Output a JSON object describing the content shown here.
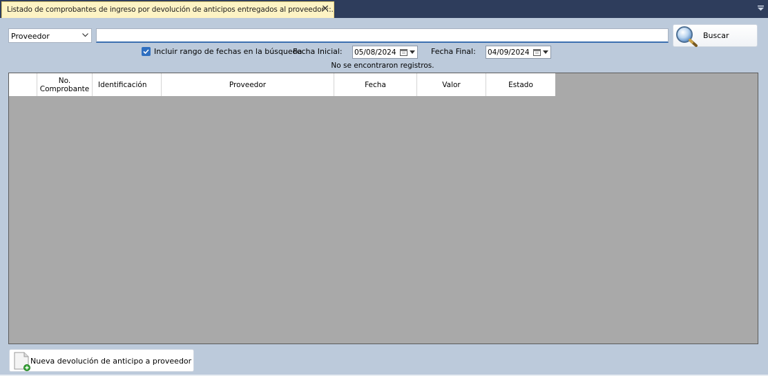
{
  "tab": {
    "title": "Listado de comprobantes de ingreso por devolución de anticipos entregados al proveedor ::.",
    "close_glyph": "✕"
  },
  "filters": {
    "field_select": {
      "value": "Proveedor"
    },
    "search": {
      "value": "",
      "placeholder": ""
    },
    "search_button_label": "Buscar",
    "date_range_checkbox": {
      "label": "Incluir rango de fechas en la búsqueda",
      "checked": true
    },
    "start_date": {
      "label": "Fecha Inicial:",
      "value": "05/08/2024"
    },
    "end_date": {
      "label": "Fecha Final:",
      "value": "04/09/2024"
    }
  },
  "status_message": "No se encontraron registros.",
  "grid": {
    "columns": [
      {
        "label": ""
      },
      {
        "label": "No.\nComprobante"
      },
      {
        "label": "Identificación"
      },
      {
        "label": "Proveedor"
      },
      {
        "label": "Fecha"
      },
      {
        "label": "Valor"
      },
      {
        "label": "Estado"
      }
    ],
    "rows": []
  },
  "footer": {
    "new_button_label": "Nueva devolución de anticipo a proveedor"
  },
  "icons": {
    "search_button": "magnifier-icon",
    "new_button": "new-document-icon",
    "calendar": "calendar-icon",
    "dropdown": "chevron-down-icon"
  },
  "colors": {
    "tab_background": "#fdf3c4",
    "titlebar": "#2e3d5c",
    "panel": "#bccadb",
    "grid_empty": "#a9a9a9",
    "accent": "#2f6fc0"
  }
}
